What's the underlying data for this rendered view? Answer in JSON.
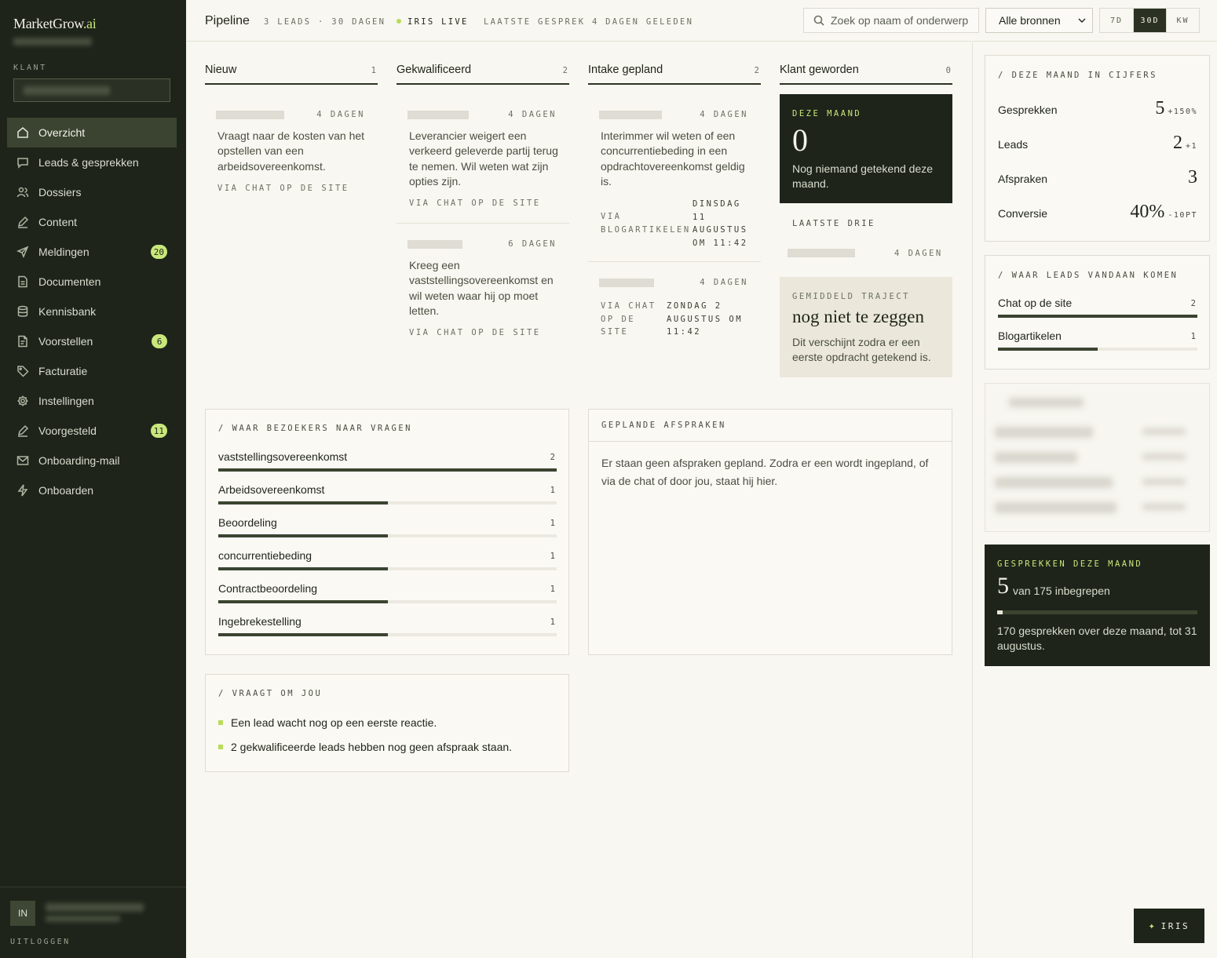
{
  "brand": {
    "name": "MarketGrow",
    "suffix": ".ai"
  },
  "sidebar": {
    "klant_label": "KLANT",
    "items": [
      {
        "label": "Overzicht",
        "icon": "home-icon",
        "active": true,
        "badge": ""
      },
      {
        "label": "Leads & gesprekken",
        "icon": "chat-icon",
        "badge": ""
      },
      {
        "label": "Dossiers",
        "icon": "users-icon",
        "badge": ""
      },
      {
        "label": "Content",
        "icon": "pen-icon",
        "badge": ""
      },
      {
        "label": "Meldingen",
        "icon": "send-icon",
        "badge": "20"
      },
      {
        "label": "Documenten",
        "icon": "document-icon",
        "badge": ""
      },
      {
        "label": "Kennisbank",
        "icon": "database-icon",
        "badge": ""
      },
      {
        "label": "Voorstellen",
        "icon": "file-icon",
        "badge": "6"
      },
      {
        "label": "Facturatie",
        "icon": "tag-icon",
        "badge": ""
      },
      {
        "label": "Instellingen",
        "icon": "gear-icon",
        "badge": ""
      },
      {
        "label": "Voorgesteld",
        "icon": "pen-icon",
        "badge": "11"
      },
      {
        "label": "Onboarding-mail",
        "icon": "mail-icon",
        "badge": ""
      },
      {
        "label": "Onboarden",
        "icon": "bolt-icon",
        "badge": ""
      }
    ],
    "avatar_initials": "IN",
    "logout": "UITLOGGEN"
  },
  "topbar": {
    "title": "Pipeline",
    "meta_leads": "3 LEADS · 30 DAGEN",
    "live": "IRIS LIVE",
    "last_chat": "LAATSTE GESPREK 4 DAGEN GELEDEN",
    "search_placeholder": "Zoek op naam of onderwerp",
    "source_select": "Alle bronnen",
    "ranges": [
      "7D",
      "30D",
      "KW"
    ],
    "active_range": "30D"
  },
  "pipeline": {
    "columns": [
      {
        "title": "Nieuw",
        "count": "1"
      },
      {
        "title": "Gekwalificeerd",
        "count": "2"
      },
      {
        "title": "Intake gepland",
        "count": "2"
      },
      {
        "title": "Klant geworden",
        "count": "0"
      }
    ],
    "new": [
      {
        "age": "4 DAGEN",
        "question": "Vraagt naar de kosten van het opstellen van een arbeidsovereenkomst.",
        "source": "VIA CHAT OP DE SITE"
      }
    ],
    "qualified": [
      {
        "age": "4 DAGEN",
        "question": "Leverancier weigert een verkeerd geleverde partij terug te nemen. Wil weten wat zijn opties zijn.",
        "source": "VIA CHAT OP DE SITE"
      },
      {
        "age": "6 DAGEN",
        "question": "Kreeg een vaststellingsovereenkomst en wil weten waar hij op moet letten.",
        "source": "VIA CHAT OP DE SITE"
      }
    ],
    "intake": [
      {
        "age": "4 DAGEN",
        "question": "Interimmer wil weten of een concurrentiebeding in een opdrachtovereenkomst geldig is.",
        "source": "VIA BLOGARTIKELEN",
        "when": "DINSDAG 11 AUGUSTUS OM 11:42"
      },
      {
        "age": "4 DAGEN",
        "question": "",
        "source": "VIA CHAT OP DE SITE",
        "when": "ZONDAG 2 AUGUSTUS OM 11:42"
      }
    ],
    "won": {
      "month_label": "DEZE MAAND",
      "month_value": "0",
      "month_text": "Nog niemand getekend deze maand.",
      "last_three_label": "LAATSTE DRIE",
      "last_age": "4 DAGEN",
      "traject_label": "GEMIDDELD TRAJECT",
      "traject_value": "nog niet te zeggen",
      "traject_text": "Dit verschijnt zodra er een eerste opdracht getekend is."
    }
  },
  "questions_panel": {
    "title": "/ WAAR BEZOEKERS NAAR VRAGEN",
    "items": [
      {
        "label": "vaststellingsovereenkomst",
        "count": 2,
        "share": 1.0
      },
      {
        "label": "Arbeidsovereenkomst",
        "count": 1,
        "share": 0.5
      },
      {
        "label": "Beoordeling",
        "count": 1,
        "share": 0.5
      },
      {
        "label": "concurrentiebeding",
        "count": 1,
        "share": 0.5
      },
      {
        "label": "Contractbeoordeling",
        "count": 1,
        "share": 0.5
      },
      {
        "label": "Ingebrekestelling",
        "count": 1,
        "share": 0.5
      }
    ]
  },
  "appointments_panel": {
    "title": "GEPLANDE AFSPRAKEN",
    "text": "Er staan geen afspraken gepland. Zodra er een wordt ingepland, of via de chat of door jou, staat hij hier."
  },
  "ask_panel": {
    "title": "/ VRAAGT OM JOU",
    "items": [
      "Een lead wacht nog op een eerste reactie.",
      "2 gekwalificeerde leads hebben nog geen afspraak staan."
    ]
  },
  "rail": {
    "kpi_title": "/ DEZE MAAND IN CIJFERS",
    "kpis": [
      {
        "label": "Gesprekken",
        "value": "5",
        "delta": "+150%"
      },
      {
        "label": "Leads",
        "value": "2",
        "delta": "+1"
      },
      {
        "label": "Afspraken",
        "value": "3",
        "delta": ""
      },
      {
        "label": "Conversie",
        "value": "40%",
        "delta": "-10PT"
      }
    ],
    "sources_title": "/ WAAR LEADS VANDAAN KOMEN",
    "sources": [
      {
        "label": "Chat op de site",
        "count": 2,
        "share": 1.0
      },
      {
        "label": "Blogartikelen",
        "count": 1,
        "share": 0.5
      }
    ],
    "quota": {
      "label": "GESPREKKEN DEZE MAAND",
      "value": "5",
      "of_text": "van 175 inbegrepen",
      "fraction": 0.029,
      "text": "170 gesprekken over deze maand, tot 31 augustus."
    },
    "iris_button": "IRIS"
  }
}
